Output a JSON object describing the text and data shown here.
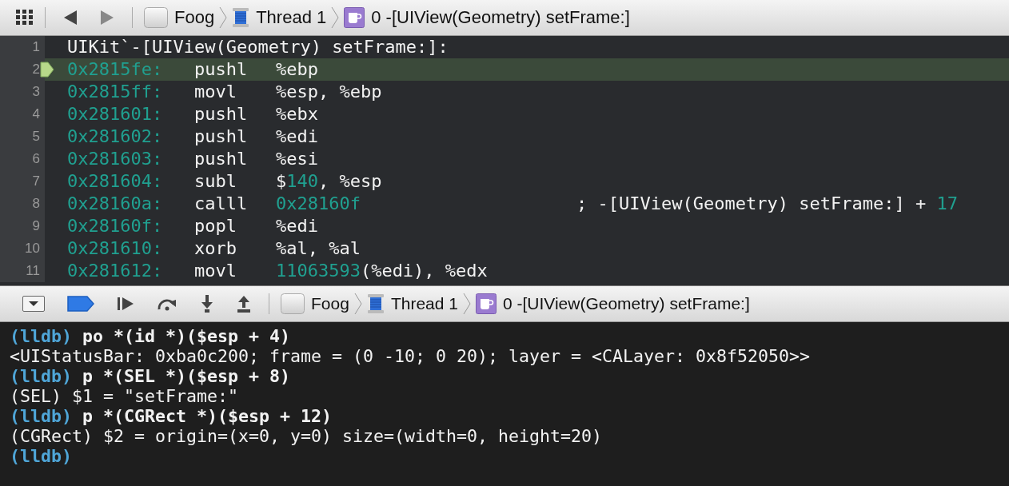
{
  "jump_bar": {
    "breadcrumbs": [
      {
        "kind": "project",
        "label": "Foog"
      },
      {
        "kind": "thread",
        "label": "Thread 1"
      },
      {
        "kind": "frame",
        "label": "0 -[UIView(Geometry) setFrame:]"
      }
    ]
  },
  "disassembly": {
    "lines": [
      {
        "number": "1",
        "kind": "symbol",
        "text": "UIKit`-[UIView(Geometry) setFrame:]:",
        "current": false
      },
      {
        "number": "2",
        "kind": "instruction",
        "address": "0x2815fe:",
        "mnemonic": "pushl",
        "operands": [
          {
            "kind": "plain",
            "text": "%ebp"
          }
        ],
        "current": true
      },
      {
        "number": "3",
        "kind": "instruction",
        "address": "0x2815ff:",
        "mnemonic": "movl",
        "operands": [
          {
            "kind": "plain",
            "text": "%esp, %ebp"
          }
        ],
        "current": false
      },
      {
        "number": "4",
        "kind": "instruction",
        "address": "0x281601:",
        "mnemonic": "pushl",
        "operands": [
          {
            "kind": "plain",
            "text": "%ebx"
          }
        ],
        "current": false
      },
      {
        "number": "5",
        "kind": "instruction",
        "address": "0x281602:",
        "mnemonic": "pushl",
        "operands": [
          {
            "kind": "plain",
            "text": "%edi"
          }
        ],
        "current": false
      },
      {
        "number": "6",
        "kind": "instruction",
        "address": "0x281603:",
        "mnemonic": "pushl",
        "operands": [
          {
            "kind": "plain",
            "text": "%esi"
          }
        ],
        "current": false
      },
      {
        "number": "7",
        "kind": "instruction",
        "address": "0x281604:",
        "mnemonic": "subl",
        "operands": [
          {
            "kind": "plain",
            "text": "$"
          },
          {
            "kind": "number",
            "text": "140"
          },
          {
            "kind": "plain",
            "text": ", %esp"
          }
        ],
        "current": false
      },
      {
        "number": "8",
        "kind": "instruction",
        "address": "0x28160a:",
        "mnemonic": "calll",
        "operands": [
          {
            "kind": "number",
            "text": "0x28160f"
          }
        ],
        "comment": [
          {
            "kind": "plain",
            "text": "; -[UIView(Geometry) setFrame:] + "
          },
          {
            "kind": "number",
            "text": "17"
          }
        ],
        "current": false
      },
      {
        "number": "9",
        "kind": "instruction",
        "address": "0x28160f:",
        "mnemonic": "popl",
        "operands": [
          {
            "kind": "plain",
            "text": "%edi"
          }
        ],
        "current": false
      },
      {
        "number": "10",
        "kind": "instruction",
        "address": "0x281610:",
        "mnemonic": "xorb",
        "operands": [
          {
            "kind": "plain",
            "text": "%al, %al"
          }
        ],
        "current": false
      },
      {
        "number": "11",
        "kind": "instruction",
        "address": "0x281612:",
        "mnemonic": "movl",
        "operands": [
          {
            "kind": "number",
            "text": "11063593"
          },
          {
            "kind": "plain",
            "text": "(%edi), %edx"
          }
        ],
        "current": false
      }
    ]
  },
  "debug_bar": {
    "breakpoints_active": true,
    "breadcrumbs": [
      {
        "kind": "project",
        "label": "Foog"
      },
      {
        "kind": "thread",
        "label": "Thread 1"
      },
      {
        "kind": "frame",
        "label": "0 -[UIView(Geometry) setFrame:]"
      }
    ]
  },
  "console": {
    "lines": [
      {
        "kind": "command",
        "prompt": "(lldb)",
        "text": "po *(id *)($esp + 4)"
      },
      {
        "kind": "output",
        "text": "<UIStatusBar: 0xba0c200; frame = (0 -10; 0 20); layer = <CALayer: 0x8f52050>>"
      },
      {
        "kind": "command",
        "prompt": "(lldb)",
        "text": "p *(SEL *)($esp + 8)"
      },
      {
        "kind": "output",
        "text": "(SEL) $1 = \"setFrame:\""
      },
      {
        "kind": "command",
        "prompt": "(lldb)",
        "text": "p *(CGRect *)($esp + 12)"
      },
      {
        "kind": "output",
        "text": "(CGRect) $2 = origin=(x=0, y=0) size=(width=0, height=20)"
      },
      {
        "kind": "command",
        "prompt": "(lldb)"
      }
    ]
  }
}
